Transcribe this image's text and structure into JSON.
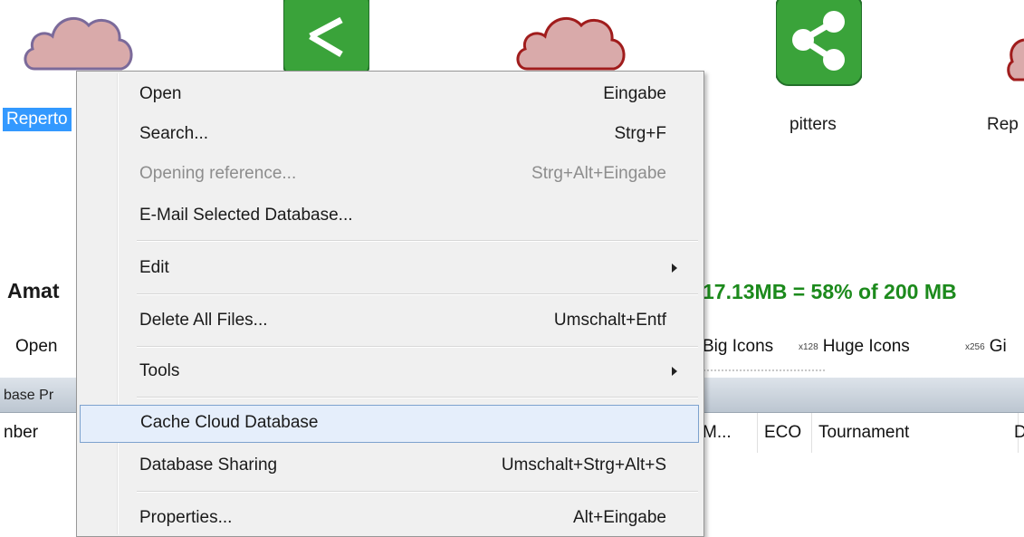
{
  "databases": [
    {
      "label": "Reperto",
      "kind": "cloud-pink",
      "selected": true
    },
    {
      "label": "",
      "kind": "share-green"
    },
    {
      "label": "",
      "kind": "cloud-red"
    },
    {
      "label": "pitters",
      "kind": "share-green"
    },
    {
      "label": "Rep",
      "kind": "cloud-red"
    }
  ],
  "info": {
    "title": "Amat",
    "space": "17.13MB = 58% of 200 MB"
  },
  "toolbar": {
    "open": "Open",
    "big_icons": "Big Icons",
    "huge_prefix": "x128",
    "huge_icons": "Huge Icons",
    "gi_prefix": "x256",
    "gi": "Gi"
  },
  "panel": {
    "label": "base Pr"
  },
  "columns": [
    "nber",
    "M...",
    "ECO",
    "Tournament",
    "D"
  ],
  "menu": {
    "items": [
      {
        "label": "Open",
        "shortcut": "Eingabe"
      },
      {
        "label": "Search...",
        "shortcut": "Strg+F"
      },
      {
        "label": "Opening reference...",
        "shortcut": "Strg+Alt+Eingabe",
        "disabled": true
      },
      {
        "label": "E-Mail Selected Database...",
        "shortcut": ""
      },
      {
        "label": "Edit",
        "shortcut": "",
        "submenu": true
      },
      {
        "label": "Delete All Files...",
        "shortcut": "Umschalt+Entf"
      },
      {
        "label": "Tools",
        "shortcut": "",
        "submenu": true
      },
      {
        "label": "Cache Cloud Database",
        "shortcut": "",
        "highlighted": true
      },
      {
        "label": "Database Sharing",
        "shortcut": "Umschalt+Strg+Alt+S"
      },
      {
        "label": "Properties...",
        "shortcut": "Alt+Eingabe"
      }
    ]
  },
  "colors": {
    "selection": "#3399ff",
    "space_green": "#1c8a1c",
    "share_green": "#3aa33a",
    "cloud_pink_fill": "#d9aaaa",
    "cloud_red_stroke": "#a01c1c",
    "menu_highlight": "#e5eefb"
  }
}
